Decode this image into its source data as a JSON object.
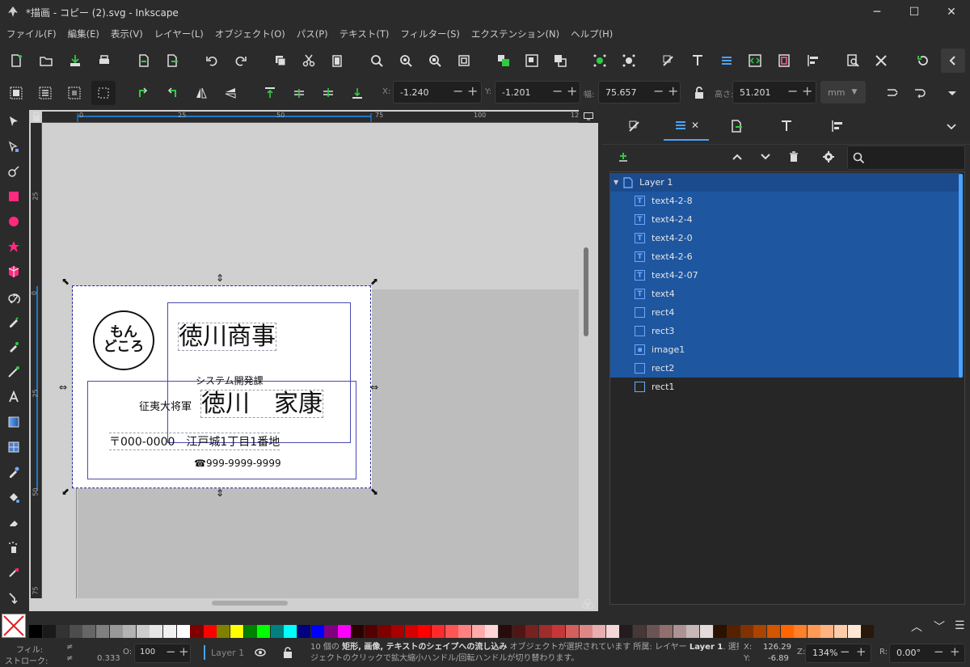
{
  "window": {
    "title": "*描画 - コピー (2).svg - Inkscape",
    "minimize": "─",
    "maximize": "☐",
    "close": "✕"
  },
  "menu": [
    "ファイル(F)",
    "編集(E)",
    "表示(V)",
    "レイヤー(L)",
    "オブジェクト(O)",
    "パス(P)",
    "テキスト(T)",
    "フィルター(S)",
    "エクステンション(N)",
    "ヘルプ(H)"
  ],
  "toolbar2": {
    "x_label": "X:",
    "x_value": "-1.240",
    "y_label": "Y:",
    "y_value": "-1.201",
    "w_label": "幅:",
    "w_value": "75.657",
    "h_label": "高さ:",
    "h_value": "51.201",
    "unit": "mm",
    "minus": "−",
    "plus": "+"
  },
  "ruler": {
    "h_ticks": [
      "0",
      "25",
      "50",
      "75",
      "100",
      "12"
    ],
    "v_ticks": [
      "25",
      "0",
      "25",
      "50",
      "75"
    ]
  },
  "card": {
    "logo_line1": "もん",
    "logo_line2": "どころ",
    "company": "徳川商事",
    "department": "システム開発課",
    "title": "征夷大将軍",
    "name": "徳川　家康",
    "address": "〒000-0000　江戸城1丁目1番地",
    "phone": "☎999-9999-9999"
  },
  "layers": {
    "close_tab": "✕",
    "root": "Layer 1",
    "items": [
      {
        "name": "text4-2-8",
        "type": "text",
        "selected": true
      },
      {
        "name": "text4-2-4",
        "type": "text",
        "selected": true
      },
      {
        "name": "text4-2-0",
        "type": "text",
        "selected": true
      },
      {
        "name": "text4-2-6",
        "type": "text",
        "selected": true
      },
      {
        "name": "text4-2-07",
        "type": "text",
        "selected": true
      },
      {
        "name": "text4",
        "type": "text",
        "selected": true
      },
      {
        "name": "rect4",
        "type": "rect",
        "selected": true
      },
      {
        "name": "rect3",
        "type": "rect",
        "selected": true
      },
      {
        "name": "image1",
        "type": "image",
        "selected": true
      },
      {
        "name": "rect2",
        "type": "rect",
        "selected": true
      },
      {
        "name": "rect1",
        "type": "rect",
        "selected": false
      }
    ]
  },
  "palette": [
    "#000000",
    "#1a1a1a",
    "#333333",
    "#4d4d4d",
    "#666666",
    "#808080",
    "#999999",
    "#b3b3b3",
    "#cccccc",
    "#e6e6e6",
    "#f2f2f2",
    "#ffffff",
    "#800000",
    "#ff0000",
    "#808000",
    "#ffff00",
    "#008000",
    "#00ff00",
    "#008080",
    "#00ffff",
    "#000080",
    "#0000ff",
    "#800080",
    "#ff00ff",
    "#2b0000",
    "#550000",
    "#800000",
    "#aa0000",
    "#d40000",
    "#ff0000",
    "#ff2a2a",
    "#ff5555",
    "#ff8080",
    "#ffaaaa",
    "#ffd5d5",
    "#280b0b",
    "#501616",
    "#782121",
    "#a02c2c",
    "#c83737",
    "#d35f5f",
    "#de8787",
    "#e9afaf",
    "#f4d7d7",
    "#241c1c",
    "#483737",
    "#6c5353",
    "#916f6f",
    "#ac9393",
    "#c8b7b7",
    "#e3dbdb",
    "#2b1100",
    "#552200",
    "#803300",
    "#aa4400",
    "#d45500",
    "#ff6600",
    "#ff7f2a",
    "#ff9955",
    "#ffb380",
    "#ffccaa",
    "#ffe6d5",
    "#28170b"
  ],
  "status": {
    "fill_label": "フィル:",
    "fill_value": "≠",
    "stroke_label": "ストローク:",
    "stroke_value": "≠",
    "stroke_width": "0.333",
    "opacity_label": "O:",
    "opacity_value": "100",
    "layer": "Layer 1",
    "message_line1_a": "10 個の ",
    "message_line1_b": "矩形, 画像, テキストのシェイプへの流し込み",
    "message_line1_c": " オブジェクトが選択されています 所属: レイヤー ",
    "message_line1_d": "Layer 1",
    "message_line1_e": ". 選択オブ",
    "message_line2": "ジェクトのクリックで拡大縮小ハンドル/回転ハンドルが切り替わります。",
    "x_label": "X:",
    "x_value": "126.29",
    "y_label": "Y:",
    "y_value": "-6.89",
    "zoom_label": "Z:",
    "zoom_value": "134%",
    "rot_label": "R:",
    "rot_value": "0.00°"
  }
}
